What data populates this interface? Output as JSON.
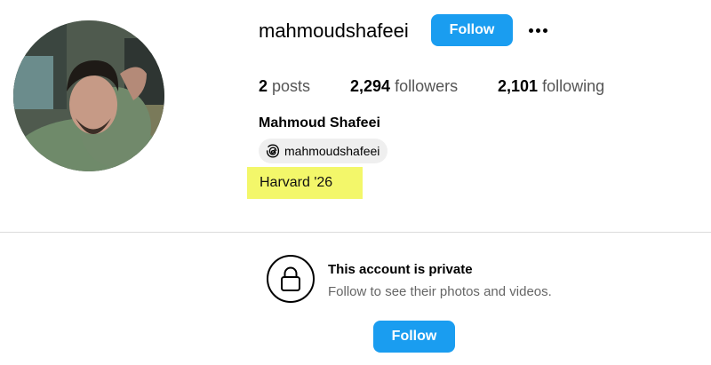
{
  "profile": {
    "username": "mahmoudshafeei",
    "full_name": "Mahmoud Shafeei",
    "threads_handle": "mahmoudshafeei",
    "bio": "Harvard '26",
    "avatar_icon": "profile-photo"
  },
  "actions": {
    "follow_label": "Follow",
    "more_icon": "more-options-icon"
  },
  "stats": {
    "posts_count": "2",
    "posts_label": "posts",
    "followers_count": "2,294",
    "followers_label": "followers",
    "following_count": "2,101",
    "following_label": "following"
  },
  "private_section": {
    "title": "This account is private",
    "subtitle": "Follow to see their photos and videos.",
    "follow_label": "Follow",
    "icon": "lock-icon"
  },
  "colors": {
    "accent": "#1a9df0",
    "highlight": "#f3f76a"
  }
}
